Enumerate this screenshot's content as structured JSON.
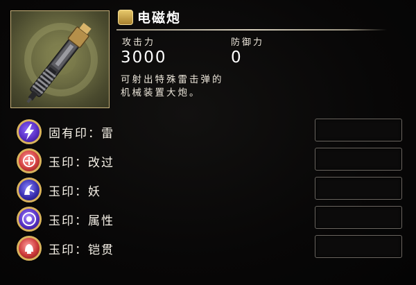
{
  "item": {
    "name": "电磁炮",
    "image_icon": "railgun-icon",
    "title_icon": "item-category-icon"
  },
  "stats": {
    "attack_label": "攻击力",
    "attack_value": "3000",
    "defense_label": "防御力",
    "defense_value": "0"
  },
  "description": {
    "line1": "可射出特殊雷击弹的",
    "line2": "机械装置大炮。"
  },
  "seals": [
    {
      "name": "固有印：雷",
      "icon": "lightning-seal-icon",
      "color": "#6a3fd1"
    },
    {
      "name": "玉印：改过",
      "icon": "reform-seal-icon",
      "color": "#c8383a"
    },
    {
      "name": "玉印：妖",
      "icon": "yokai-seal-icon",
      "color": "#4b3fb8"
    },
    {
      "name": "玉印：属性",
      "icon": "attribute-seal-icon",
      "color": "#5a3fc4"
    },
    {
      "name": "玉印：铠贯",
      "icon": "armor-pierce-seal-icon",
      "color": "#c43a3a"
    }
  ],
  "colors": {
    "frame_gold": "#c9b27a",
    "background": "#050404"
  }
}
